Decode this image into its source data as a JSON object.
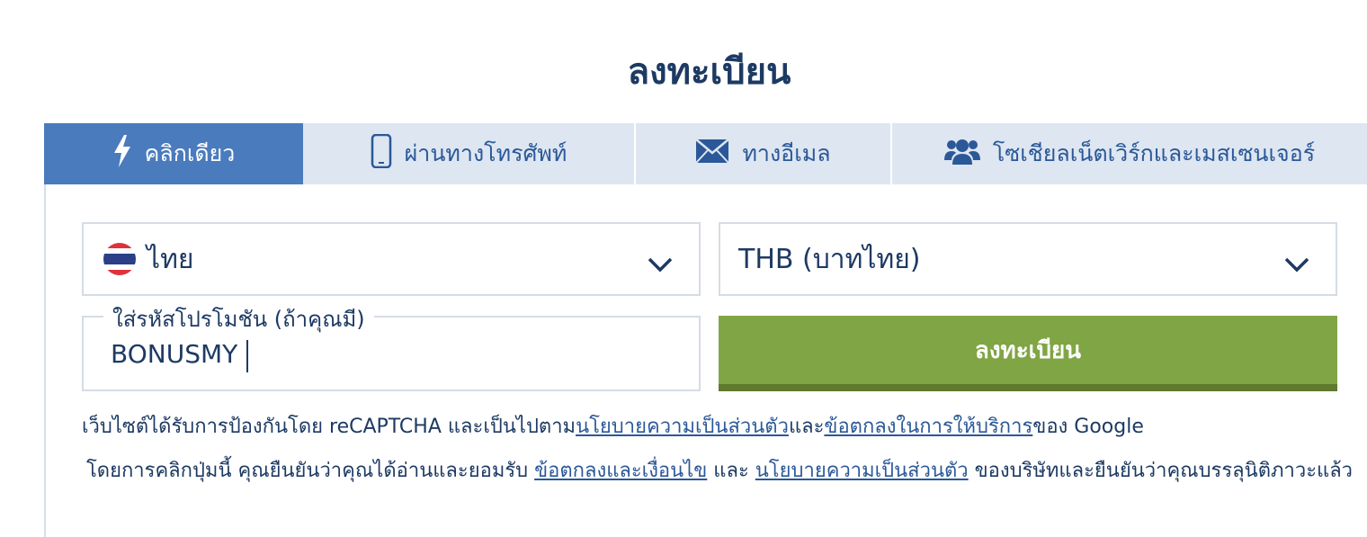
{
  "page_title": "ลงทะเบียน",
  "tabs": [
    {
      "label": "คลิกเดียว",
      "icon": "lightning-icon",
      "active": true
    },
    {
      "label": "ผ่านทางโทรศัพท์",
      "icon": "mobile-phone-icon",
      "active": false
    },
    {
      "label": "ทางอีเมล",
      "icon": "envelope-icon",
      "active": false
    },
    {
      "label": "โซเชียลเน็ตเวิร์กและเมสเซนเจอร์",
      "icon": "users-icon",
      "active": false
    }
  ],
  "country_select": {
    "value": "ไทย",
    "icon": "thailand-flag-icon"
  },
  "currency_select": {
    "value": "THB (บาทไทย)"
  },
  "promo": {
    "label": "ใส่รหัสโปรโมชัน (ถ้าคุณมี)",
    "value": "BONUSMY"
  },
  "register_button": {
    "label": "ลงทะเบียน"
  },
  "recaptcha": {
    "prefix": "เว็บไซต์ได้รับการป้องกันโดย reCAPTCHA และเป็นไปตาม",
    "privacy_link": "นโยบายความเป็นส่วนตัว",
    "and": "และ",
    "terms_link": "ข้อตกลงในการให้บริการ",
    "suffix": "ของ Google"
  },
  "agreement": {
    "prefix": "โดยการคลิกปุ่มนี้ คุณยืนยันว่าคุณได้อ่านและยอมรับ ",
    "terms_link": "ข้อตกลงและเงื่อนไข",
    "and": " และ ",
    "privacy_link": "นโยบายความเป็นส่วนตัว",
    "suffix": " ของบริษัทและยืนยันว่าคุณบรรลุนิติภาวะแล้ว"
  },
  "colors": {
    "primary": "#1d3a63",
    "tab_active": "#4a7bbd",
    "tab_inactive": "#dde6f1",
    "register_button": "#80a544"
  }
}
